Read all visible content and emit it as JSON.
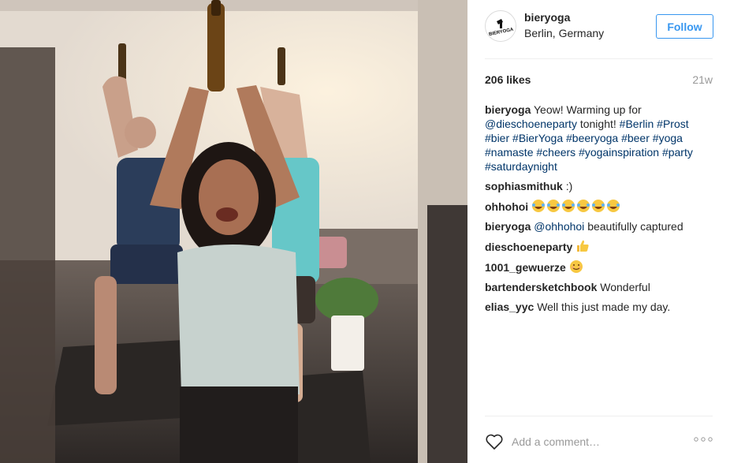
{
  "post": {
    "username": "bieryoga",
    "location": "Berlin, Germany",
    "follow_label": "Follow",
    "likes": "206 likes",
    "time": "21w",
    "avatar_text": "BIERYOGA"
  },
  "caption": {
    "username": "bieryoga",
    "t1": "Yeow! Warming up for",
    "mention": "@dieschoeneparty",
    "t2": "tonight!",
    "tags": [
      "#Berlin",
      "#Prost",
      "#bier",
      "#BierYoga",
      "#beeryoga",
      "#beer",
      "#yoga",
      "#namaste",
      "#cheers",
      "#yogainspiration",
      "#party",
      "#saturdaynight"
    ]
  },
  "comments": [
    {
      "user": "sophiasmithuk",
      "text": ":)"
    },
    {
      "user": "ohhohoi",
      "text": "",
      "emoji": "laughing-tears-emoji x6"
    },
    {
      "user": "bieryoga",
      "mention": "@ohhohoi",
      "text": "beautifully captured"
    },
    {
      "user": "dieschoeneparty",
      "text": "",
      "emoji": "thumbs-up-emoji"
    },
    {
      "user": "1001_gewuerze",
      "text": "",
      "emoji": "smiling-emoji"
    },
    {
      "user": "bartendersketchbook",
      "text": "Wonderful"
    },
    {
      "user": "elias_yyc",
      "text": "Well this just made my day."
    }
  ],
  "comment_box": {
    "placeholder": "Add a comment…"
  },
  "icons": {
    "like": "heart-icon",
    "more": "more-options-icon"
  },
  "colors": {
    "link": "#003569",
    "follow": "#3897f0",
    "muted": "#999999",
    "text": "#262626"
  }
}
